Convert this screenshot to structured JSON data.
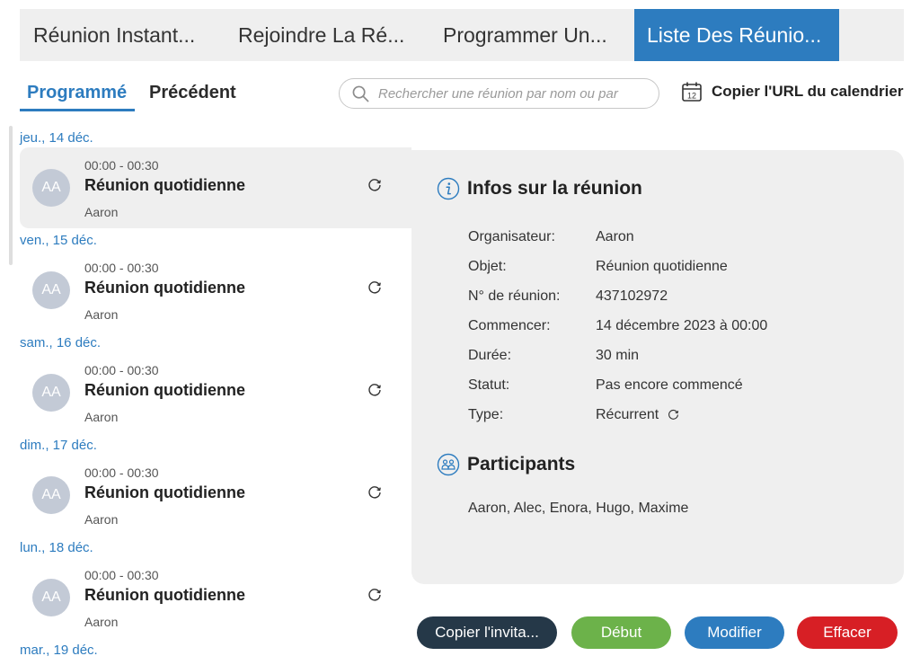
{
  "top_tabs": [
    {
      "label": "Réunion Instant..."
    },
    {
      "label": "Rejoindre La Ré..."
    },
    {
      "label": "Programmer Un..."
    },
    {
      "label": "Liste Des Réunio..."
    }
  ],
  "sub_tabs": {
    "scheduled": "Programmé",
    "previous": "Précédent"
  },
  "search": {
    "placeholder": "Rechercher une réunion par nom ou par"
  },
  "calendar": {
    "copy_label": "Copier l'URL du calendrier",
    "icon_day": "12"
  },
  "meetings": [
    {
      "date": "jeu., 14 déc.",
      "time": "00:00 - 00:30",
      "title": "Réunion quotidienne",
      "host": "Aaron",
      "initials": "AA"
    },
    {
      "date": "ven., 15 déc.",
      "time": "00:00 - 00:30",
      "title": "Réunion quotidienne",
      "host": "Aaron",
      "initials": "AA"
    },
    {
      "date": "sam., 16 déc.",
      "time": "00:00 - 00:30",
      "title": "Réunion quotidienne",
      "host": "Aaron",
      "initials": "AA"
    },
    {
      "date": "dim., 17 déc.",
      "time": "00:00 - 00:30",
      "title": "Réunion quotidienne",
      "host": "Aaron",
      "initials": "AA"
    },
    {
      "date": "lun., 18 déc.",
      "time": "00:00 - 00:30",
      "title": "Réunion quotidienne",
      "host": "Aaron",
      "initials": "AA"
    }
  ],
  "next_date": "mar., 19 déc.",
  "details": {
    "info_heading": "Infos sur la réunion",
    "rows": [
      {
        "label": "Organisateur:",
        "value": "Aaron"
      },
      {
        "label": "Objet:",
        "value": "Réunion quotidienne"
      },
      {
        "label": "N° de réunion:",
        "value": "437102972"
      },
      {
        "label": "Commencer:",
        "value": "14 décembre 2023 à 00:00"
      },
      {
        "label": "Durée:",
        "value": "30 min"
      },
      {
        "label": "Statut:",
        "value": "Pas encore commencé"
      },
      {
        "label": "Type:",
        "value": "Récurrent"
      }
    ],
    "participants_heading": "Participants",
    "participants": "Aaron, Alec, Enora, Hugo, Maxime"
  },
  "buttons": {
    "copy": "Copier l'invita...",
    "start": "Début",
    "edit": "Modifier",
    "delete": "Effacer"
  },
  "colors": {
    "accent": "#2d7cbf",
    "start": "#6cb24a",
    "delete": "#d71f25",
    "dark": "#253848",
    "avatar": "#c3cad6"
  }
}
